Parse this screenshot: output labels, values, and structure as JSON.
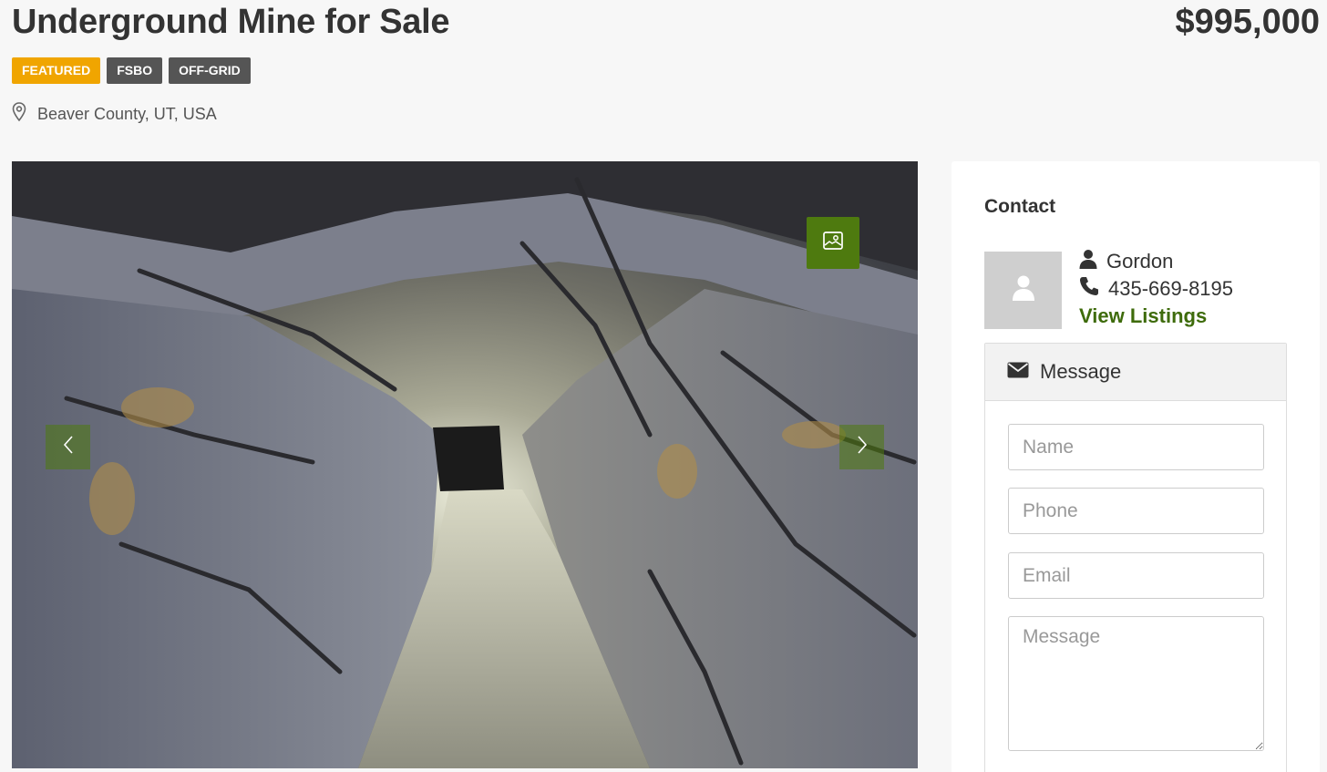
{
  "listing": {
    "title": "Underground Mine for Sale",
    "price": "$995,000",
    "badges": [
      {
        "label": "FEATURED",
        "color": "#f0a500"
      },
      {
        "label": "FSBO",
        "color": "#555555"
      },
      {
        "label": "OFF-GRID",
        "color": "#555555"
      }
    ],
    "location": "Beaver County, UT, USA"
  },
  "gallery": {
    "image_subject": "mine tunnel",
    "accent_color": "#4e7a0f"
  },
  "contact": {
    "heading": "Contact",
    "agent_name": "Gordon",
    "agent_phone": "435-669-8195",
    "view_listings": "View Listings",
    "message_tab": "Message",
    "form": {
      "name_placeholder": "Name",
      "phone_placeholder": "Phone",
      "email_placeholder": "Email",
      "message_placeholder": "Message"
    }
  }
}
